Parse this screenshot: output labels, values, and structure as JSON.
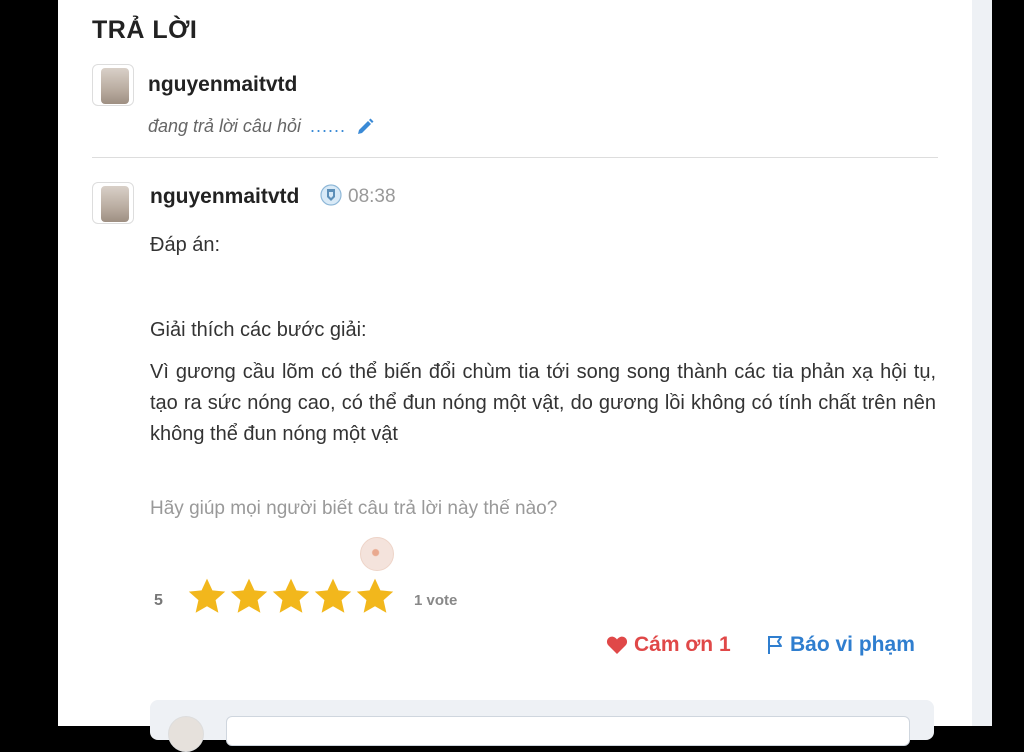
{
  "section": {
    "title": "TRẢ LỜI"
  },
  "typing_user": {
    "username": "nguyenmaitvtd",
    "status": "đang trả lời câu hỏi",
    "dots": "......"
  },
  "answer": {
    "username": "nguyenmaitvtd",
    "time": "08:38",
    "answer_label": "Đáp án:",
    "explain_label": "Giải thích các bước giải:",
    "body": " Vì gương cầu lõm có thể biến đổi chùm tia tới song song thành các tia phản xạ hội tụ, tạo ra sức nóng cao, có thể đun nóng một vật, do gương lồi không có tính chất trên nên không thể đun nóng một vật",
    "prompt": "Hãy giúp mọi người biết câu trả lời này thế nào?"
  },
  "rating": {
    "value": "5",
    "stars": 5,
    "votes": "1 vote",
    "star_color": "#f2b71c"
  },
  "actions": {
    "thanks_label": "Cám ơn 1",
    "report_label": "Báo vi phạm",
    "thanks_color": "#e04848",
    "report_color": "#2f7ecf"
  },
  "comment": {
    "placeholder": ""
  }
}
